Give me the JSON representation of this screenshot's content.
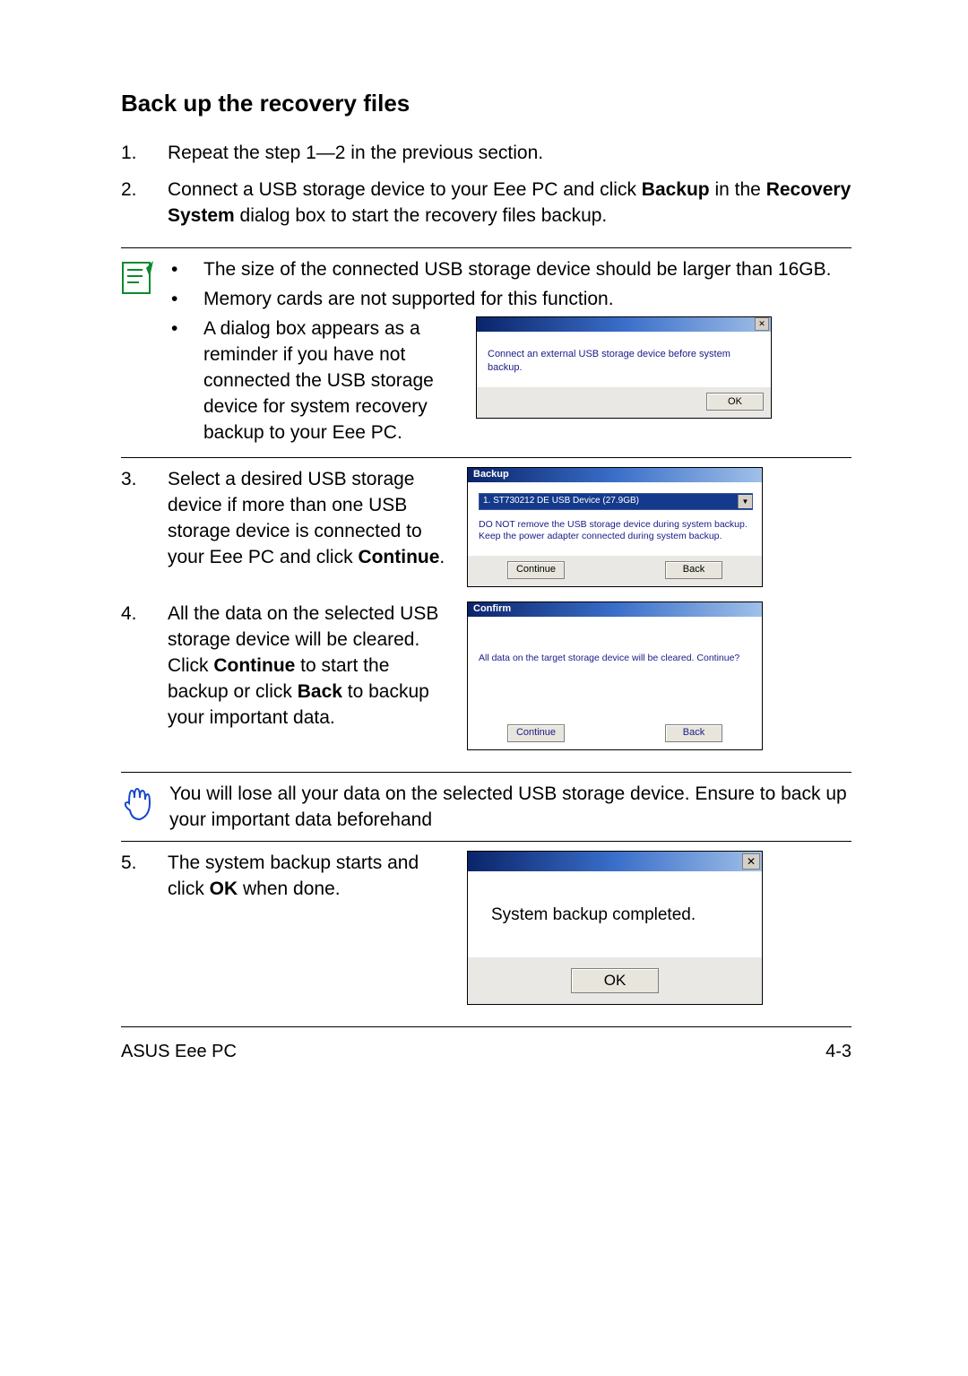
{
  "heading": "Back up the recovery files",
  "step1": {
    "num": "1.",
    "text": "Repeat the step 1—2 in the previous section."
  },
  "step2": {
    "num": "2.",
    "prefix": "Connect a USB storage device to your Eee PC and click ",
    "bold1": "Backup",
    "mid": " in the ",
    "bold2": "Recovery System",
    "suffix": " dialog box to start the recovery files backup."
  },
  "notes": {
    "b1": "The size of the connected USB storage device should be larger than 16GB.",
    "b2": "Memory cards are not supported for this function.",
    "b3": "A dialog box appears as a reminder if you have not connected the USB storage device for system recovery backup to your Eee PC."
  },
  "dlg1": {
    "msg": "Connect an external USB storage device before system backup.",
    "ok": "OK"
  },
  "step3": {
    "num": "3.",
    "prefix": "Select a desired USB storage device if more than one USB storage device is connected to your Eee PC and click ",
    "bold": "Continue",
    "suffix": "."
  },
  "dlg2": {
    "title": "Backup",
    "device": "1. ST730212 DE USB Device  (27.9GB)",
    "note": "DO NOT remove the USB storage device during system backup. Keep the power adapter connected during system backup.",
    "continue": "Continue",
    "back": "Back"
  },
  "step4": {
    "num": "4.",
    "t1": "All the data on the selected USB storage device will be cleared. Click ",
    "b1": "Continue",
    "t2": " to start the backup or click ",
    "b2": "Back",
    "t3": " to backup your important data."
  },
  "dlg3": {
    "title": "Confirm",
    "msg": "All data on the target storage device will be cleared. Continue?",
    "continue": "Continue",
    "back": "Back"
  },
  "warn": "You will lose all your data on the selected USB storage device. Ensure to back up your important data beforehand",
  "step5": {
    "num": "5.",
    "t1": "The system backup starts and click ",
    "b1": "OK",
    "t2": " when done."
  },
  "dlg4": {
    "msg": "System backup completed.",
    "ok": "OK"
  },
  "footer": {
    "left": "ASUS Eee PC",
    "right": "4-3"
  }
}
